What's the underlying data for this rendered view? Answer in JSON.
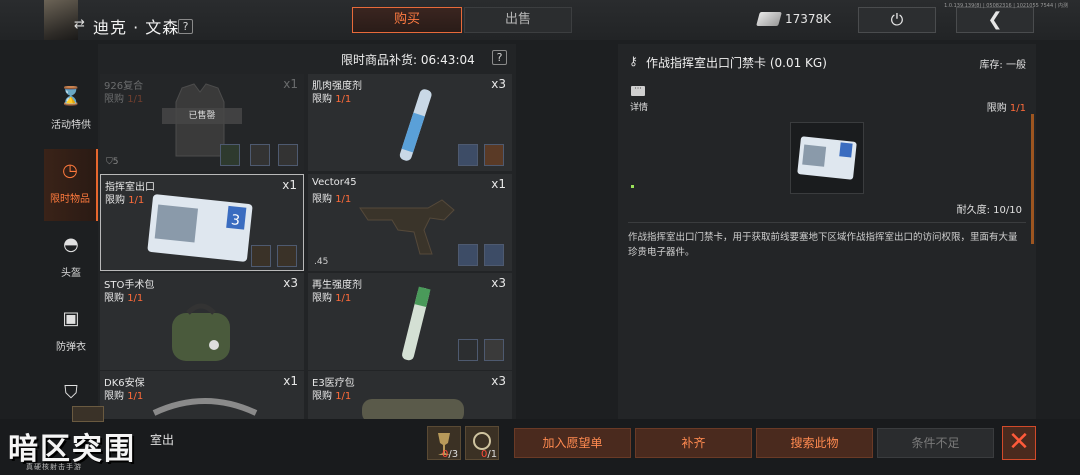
{
  "header": {
    "player_name": "迪克 · 文森",
    "help": "?",
    "tabs": [
      {
        "label": "购买",
        "active": true
      },
      {
        "label": "出售",
        "active": false
      }
    ],
    "currency_amount": "17378K",
    "power_icon": "⏻",
    "back_icon": "❮",
    "version": "1.0.139.139(8) | 05082316 | 1021055 7544 | 内测"
  },
  "categories": [
    {
      "label": "活动特供",
      "icon": "hourglass-icon"
    },
    {
      "label": "限时物品",
      "icon": "clock-icon",
      "active": true
    },
    {
      "label": "头盔",
      "icon": "helmet-icon"
    },
    {
      "label": "防弹衣",
      "icon": "vest-icon"
    },
    {
      "label": "",
      "icon": "pack-icon"
    }
  ],
  "shop": {
    "restock_label": "限时商品补货: 06:43:04",
    "limit_prefix": "限购 ",
    "sold_out": "已售罄",
    "items": [
      {
        "name": "926复合",
        "limit": "1/1",
        "qty": "x1",
        "sold_out": true,
        "level": "5"
      },
      {
        "name": "肌肉强度剂",
        "limit": "1/1",
        "qty": "x3"
      },
      {
        "name": "指挥室出口",
        "limit": "1/1",
        "qty": "x1",
        "selected": true
      },
      {
        "name": "Vector45",
        "limit": "1/1",
        "qty": "x1",
        "caliber": ".45"
      },
      {
        "name": "STO手术包",
        "limit": "1/1",
        "qty": "x3"
      },
      {
        "name": "再生强度剂",
        "limit": "1/1",
        "qty": "x3"
      },
      {
        "name": "DK6安保",
        "limit": "1/1",
        "qty": "x1"
      },
      {
        "name": "E3医疗包",
        "limit": "1/1",
        "qty": "x3"
      }
    ]
  },
  "detail": {
    "title": "作战指挥室出口门禁卡 (0.01 KG)",
    "stock": "库存: 一般",
    "more_label": "详情",
    "limit": "1/1",
    "durability": "耐久度: 10/10",
    "description": "作战指挥室出口门禁卡，用于获取前线要塞地下区域作战指挥室出口的访问权限，里面有大量珍贵电子器件。"
  },
  "bottom": {
    "selected_name": "室出",
    "requirements": [
      {
        "have": "0",
        "need": "/3"
      },
      {
        "have": "0",
        "need": "/1"
      }
    ],
    "buttons": [
      "加入愿望单",
      "补齐",
      "搜索此物",
      "条件不足"
    ],
    "close_icon": "✕"
  },
  "logo": {
    "title": "暗区突围",
    "subtitle": "真硬核射击手游"
  },
  "colors": {
    "accent": "#ff7b42",
    "limit_value": "#ff6b3a"
  }
}
